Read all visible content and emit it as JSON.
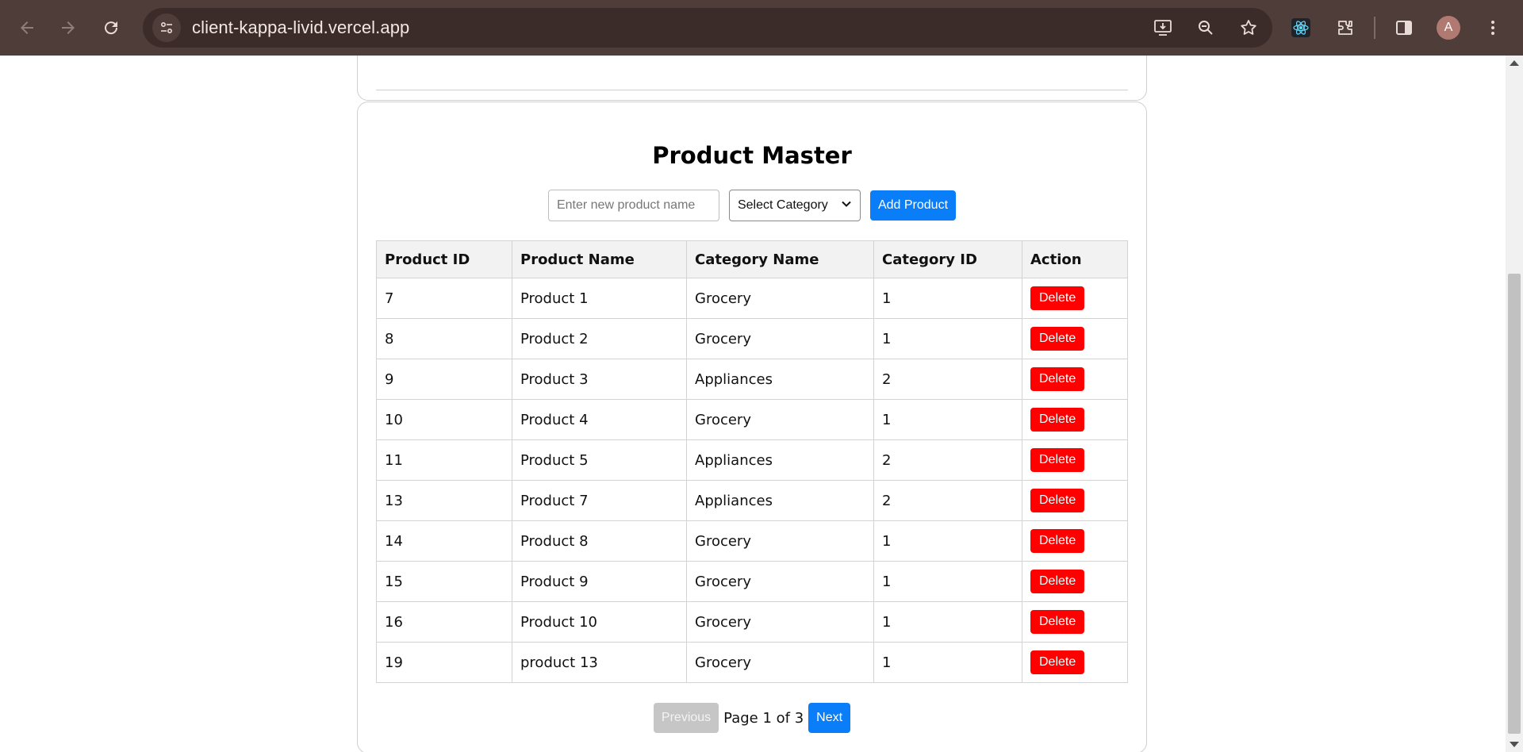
{
  "browser": {
    "url": "client-kappa-livid.vercel.app",
    "profile_initial": "A",
    "icons": [
      "back-icon",
      "forward-icon",
      "reload-icon",
      "site-settings-icon",
      "install-app-icon",
      "zoom-icon",
      "bookmark-star-icon",
      "react-devtools-icon",
      "extensions-icon",
      "side-panel-icon",
      "menu-icon"
    ]
  },
  "product_master": {
    "title": "Product Master",
    "new_product_placeholder": "Enter new product name",
    "category_select": "Select Category",
    "add_button": "Add Product",
    "columns": [
      "Product ID",
      "Product Name",
      "Category Name",
      "Category ID",
      "Action"
    ],
    "rows": [
      {
        "id": "7",
        "name": "Product 1",
        "category": "Grocery",
        "category_id": "1",
        "action": "Delete"
      },
      {
        "id": "8",
        "name": "Product 2",
        "category": "Grocery",
        "category_id": "1",
        "action": "Delete"
      },
      {
        "id": "9",
        "name": "Product 3",
        "category": "Appliances",
        "category_id": "2",
        "action": "Delete"
      },
      {
        "id": "10",
        "name": "Product 4",
        "category": "Grocery",
        "category_id": "1",
        "action": "Delete"
      },
      {
        "id": "11",
        "name": "Product 5",
        "category": "Appliances",
        "category_id": "2",
        "action": "Delete"
      },
      {
        "id": "13",
        "name": "Product 7",
        "category": "Appliances",
        "category_id": "2",
        "action": "Delete"
      },
      {
        "id": "14",
        "name": "Product 8",
        "category": "Grocery",
        "category_id": "1",
        "action": "Delete"
      },
      {
        "id": "15",
        "name": "Product 9",
        "category": "Grocery",
        "category_id": "1",
        "action": "Delete"
      },
      {
        "id": "16",
        "name": "Product 10",
        "category": "Grocery",
        "category_id": "1",
        "action": "Delete"
      },
      {
        "id": "19",
        "name": "product 13",
        "category": "Grocery",
        "category_id": "1",
        "action": "Delete"
      }
    ],
    "pagination": {
      "previous": "Previous",
      "status": "Page 1 of 3",
      "next": "Next"
    }
  },
  "colors": {
    "primary": "#0a7df9",
    "danger": "#ff0000",
    "disabled": "#c6c6c6",
    "chrome": "#4f3d3a"
  }
}
